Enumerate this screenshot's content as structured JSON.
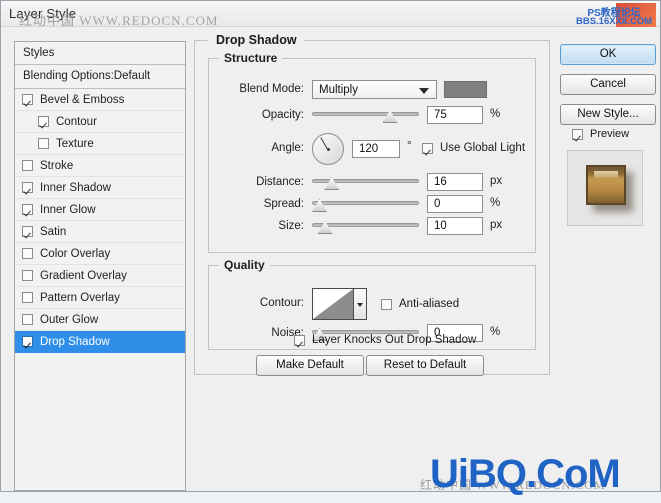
{
  "window": {
    "title": "Layer Style"
  },
  "watermarks": {
    "top": "红动中国 WWW.REDOCN.COM",
    "corner_line1": "PS教程论坛",
    "corner_line2": "BBS.16XX8.COM",
    "bottom": "UiBQ.CoM",
    "bottom_sub": "红动中国 WWW.REDOCN.COM"
  },
  "styles_panel": {
    "header": "Styles",
    "blending_options": "Blending Options:Default",
    "effects": [
      {
        "label": "Bevel & Emboss",
        "checked": true,
        "indent": false,
        "selected": false
      },
      {
        "label": "Contour",
        "checked": true,
        "indent": true,
        "selected": false
      },
      {
        "label": "Texture",
        "checked": false,
        "indent": true,
        "selected": false
      },
      {
        "label": "Stroke",
        "checked": false,
        "indent": false,
        "selected": false
      },
      {
        "label": "Inner Shadow",
        "checked": true,
        "indent": false,
        "selected": false
      },
      {
        "label": "Inner Glow",
        "checked": true,
        "indent": false,
        "selected": false
      },
      {
        "label": "Satin",
        "checked": true,
        "indent": false,
        "selected": false
      },
      {
        "label": "Color Overlay",
        "checked": false,
        "indent": false,
        "selected": false
      },
      {
        "label": "Gradient Overlay",
        "checked": false,
        "indent": false,
        "selected": false
      },
      {
        "label": "Pattern Overlay",
        "checked": false,
        "indent": false,
        "selected": false
      },
      {
        "label": "Outer Glow",
        "checked": false,
        "indent": false,
        "selected": false
      },
      {
        "label": "Drop Shadow",
        "checked": true,
        "indent": false,
        "selected": true
      }
    ]
  },
  "effect": {
    "title": "Drop Shadow",
    "structure": {
      "legend": "Structure",
      "blend_mode_label": "Blend Mode:",
      "blend_mode_value": "Multiply",
      "shadow_color": "#808080",
      "opacity_label": "Opacity:",
      "opacity_value": "75",
      "opacity_unit": "%",
      "opacity_percent": 75,
      "angle_label": "Angle:",
      "angle_value": "120",
      "angle_unit": "°",
      "use_global_light_label": "Use Global Light",
      "use_global_light_checked": true,
      "distance_label": "Distance:",
      "distance_value": "16",
      "distance_unit": "px",
      "distance_percent": 13,
      "spread_label": "Spread:",
      "spread_value": "0",
      "spread_unit": "%",
      "spread_percent": 0,
      "size_label": "Size:",
      "size_value": "10",
      "size_unit": "px",
      "size_percent": 6
    },
    "quality": {
      "legend": "Quality",
      "contour_label": "Contour:",
      "anti_aliased_label": "Anti-aliased",
      "anti_aliased_checked": false,
      "noise_label": "Noise:",
      "noise_value": "0",
      "noise_unit": "%",
      "noise_percent": 0
    },
    "knockout": {
      "label": "Layer Knocks Out Drop Shadow",
      "checked": true
    },
    "buttons": {
      "make_default": "Make Default",
      "reset_to_default": "Reset to Default"
    }
  },
  "actions": {
    "ok": "OK",
    "cancel": "Cancel",
    "new_style": "New Style...",
    "preview_label": "Preview",
    "preview_checked": true
  },
  "colors": {
    "selection_blue": "#2f8fe8",
    "primary_button": "#bfdcf2",
    "watermark_blue": "#1f63c4"
  }
}
